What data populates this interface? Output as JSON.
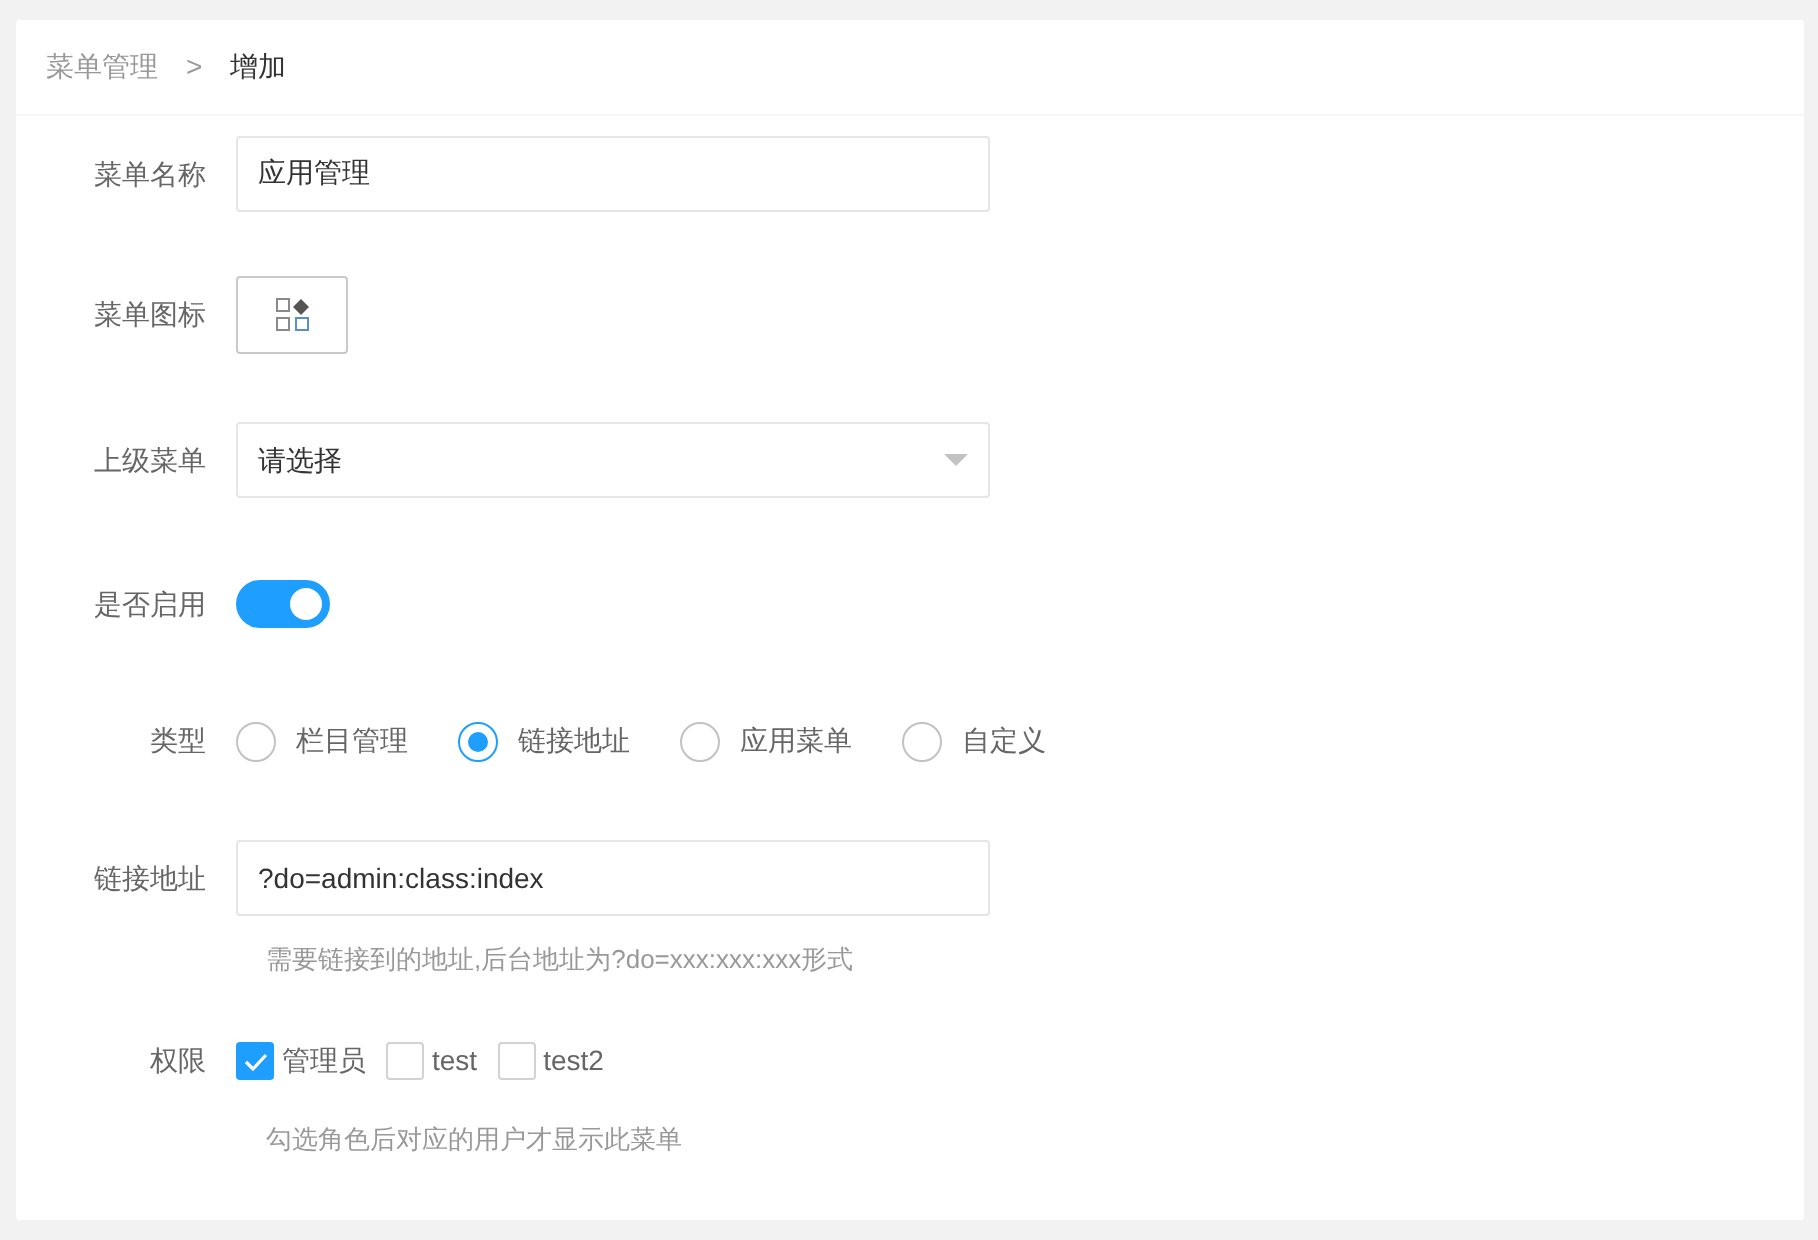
{
  "breadcrumb": {
    "items": [
      {
        "text": "菜单管理",
        "selected": false
      },
      {
        "text": "增加",
        "selected": true
      }
    ],
    "separator": ">"
  },
  "fields": [
    {
      "kind": "text",
      "label": "菜单名称",
      "value": "应用管理"
    },
    {
      "kind": "icon",
      "label": "菜单图标"
    },
    {
      "kind": "select",
      "label": "上级菜单",
      "value": "请选择"
    },
    {
      "kind": "switch",
      "label": "是否启用",
      "on": true
    },
    {
      "kind": "radio",
      "label": "类型",
      "options": [
        {
          "text": "栏目管理",
          "selected": false
        },
        {
          "text": "链接地址",
          "selected": true
        },
        {
          "text": "应用菜单",
          "selected": false
        },
        {
          "text": "自定义",
          "selected": false
        }
      ]
    },
    {
      "kind": "text",
      "label": "链接地址",
      "value": "?do=admin:class:index",
      "help": "需要链接到的地址,后台地址为?do=xxx:xxx:xxx形式"
    },
    {
      "kind": "checkbox",
      "label": "权限",
      "options": [
        {
          "text": "管理员",
          "checked": true
        },
        {
          "text": "test",
          "checked": false
        },
        {
          "text": "test2",
          "checked": false
        }
      ],
      "help": "勾选角色后对应的用户才显示此菜单"
    }
  ]
}
